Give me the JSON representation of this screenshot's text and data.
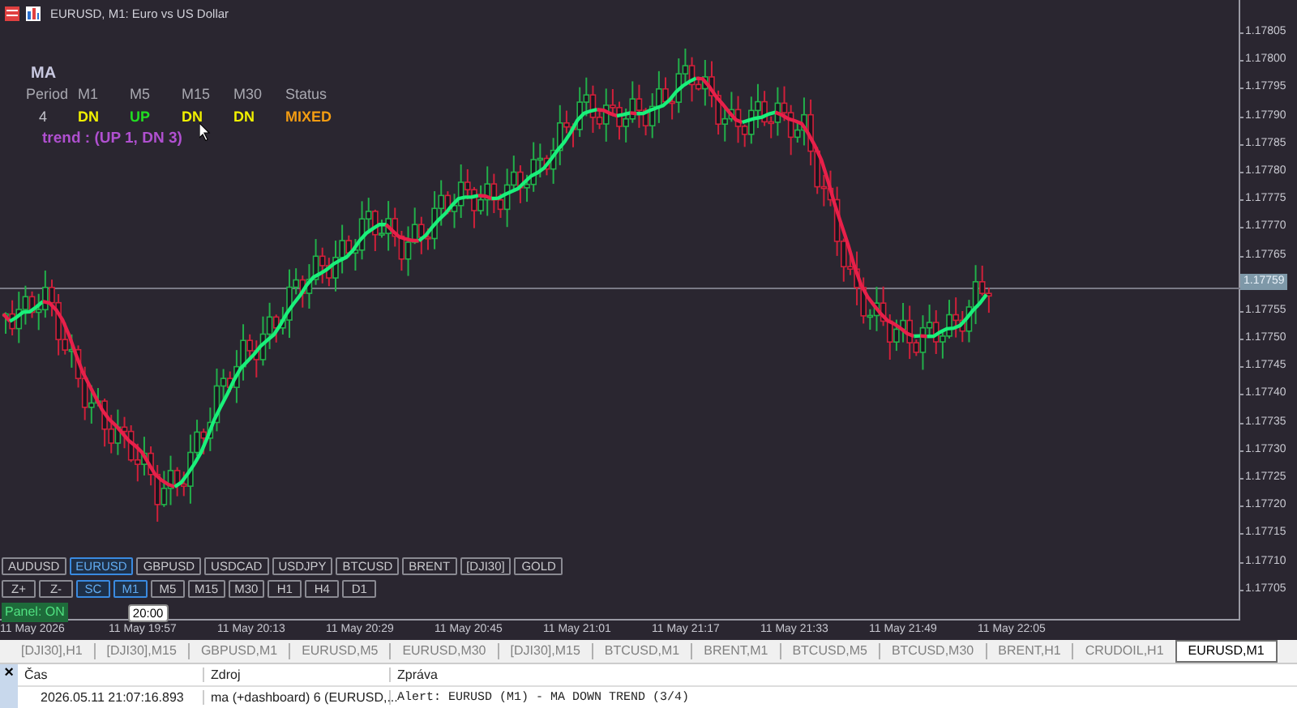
{
  "window": {
    "title": "EURUSD, M1:  Euro vs US Dollar"
  },
  "dashboard": {
    "title": "MA",
    "headers": [
      "Period",
      "M1",
      "M5",
      "M15",
      "M30",
      "Status"
    ],
    "period": "4",
    "signals": [
      {
        "text": "DN",
        "color": "#f0f000"
      },
      {
        "text": "UP",
        "color": "#22dd22"
      },
      {
        "text": "DN",
        "color": "#f0f000"
      },
      {
        "text": "DN",
        "color": "#f0f000"
      }
    ],
    "status": {
      "text": "MIXED",
      "color": "#f39c12"
    },
    "trend": "trend : (UP 1, DN 3)"
  },
  "symbol_buttons": [
    {
      "label": "AUDUSD",
      "selected": false
    },
    {
      "label": "EURUSD",
      "selected": true
    },
    {
      "label": "GBPUSD",
      "selected": false
    },
    {
      "label": "USDCAD",
      "selected": false
    },
    {
      "label": "USDJPY",
      "selected": false
    },
    {
      "label": "BTCUSD",
      "selected": false
    },
    {
      "label": "BRENT",
      "selected": false
    },
    {
      "label": "[DJI30]",
      "selected": false
    },
    {
      "label": "GOLD",
      "selected": false
    }
  ],
  "timeframe_buttons": [
    {
      "label": "Z+",
      "selected": false
    },
    {
      "label": "Z-",
      "selected": false
    },
    {
      "label": "SC",
      "selected": true
    },
    {
      "label": "M1",
      "selected": true
    },
    {
      "label": "M5",
      "selected": false
    },
    {
      "label": "M15",
      "selected": false
    },
    {
      "label": "M30",
      "selected": false
    },
    {
      "label": "H1",
      "selected": false
    },
    {
      "label": "H4",
      "selected": false
    },
    {
      "label": "D1",
      "selected": false
    }
  ],
  "panel_toggle": {
    "label": "Panel: ON",
    "on": true
  },
  "time_cursor": "20:00",
  "price_axis": {
    "ticks_above": [
      "1.17805",
      "1.17800",
      "1.17795",
      "1.17790",
      "1.17785",
      "1.17780",
      "1.17775",
      "1.17770",
      "1.17765"
    ],
    "current_price": "1.17759",
    "ticks_below": [
      "1.17755",
      "1.17750",
      "1.17745",
      "1.17740",
      "1.17735",
      "1.17730",
      "1.17725",
      "1.17720",
      "1.17715",
      "1.17710",
      "1.17705"
    ]
  },
  "time_axis": [
    "11 May 2026",
    "11 May 19:57",
    "11 May 20:13",
    "11 May 20:29",
    "11 May 20:45",
    "11 May 21:01",
    "11 May 21:17",
    "11 May 21:33",
    "11 May 21:49",
    "11 May 22:05"
  ],
  "chart_tabs": [
    {
      "label": "[DJI30],H1",
      "selected": false
    },
    {
      "label": "[DJI30],M15",
      "selected": false
    },
    {
      "label": "GBPUSD,M1",
      "selected": false
    },
    {
      "label": "EURUSD,M5",
      "selected": false
    },
    {
      "label": "EURUSD,M30",
      "selected": false
    },
    {
      "label": "[DJI30],M15",
      "selected": false
    },
    {
      "label": "BTCUSD,M1",
      "selected": false
    },
    {
      "label": "BRENT,M1",
      "selected": false
    },
    {
      "label": "BTCUSD,M5",
      "selected": false
    },
    {
      "label": "BTCUSD,M30",
      "selected": false
    },
    {
      "label": "BRENT,H1",
      "selected": false
    },
    {
      "label": "CRUDOIL,H1",
      "selected": false
    },
    {
      "label": "EURUSD,M1",
      "selected": true
    }
  ],
  "log": {
    "close": "×",
    "columns": [
      "Čas",
      "Zdroj",
      "Zpráva"
    ],
    "rows": [
      {
        "time": "2026.05.11 21:07:16.893",
        "source": "ma (+dashboard) 6 (EURUSD,...",
        "message": "Alert: EURUSD (M1) - MA DOWN TREND (3/4)"
      }
    ]
  }
}
